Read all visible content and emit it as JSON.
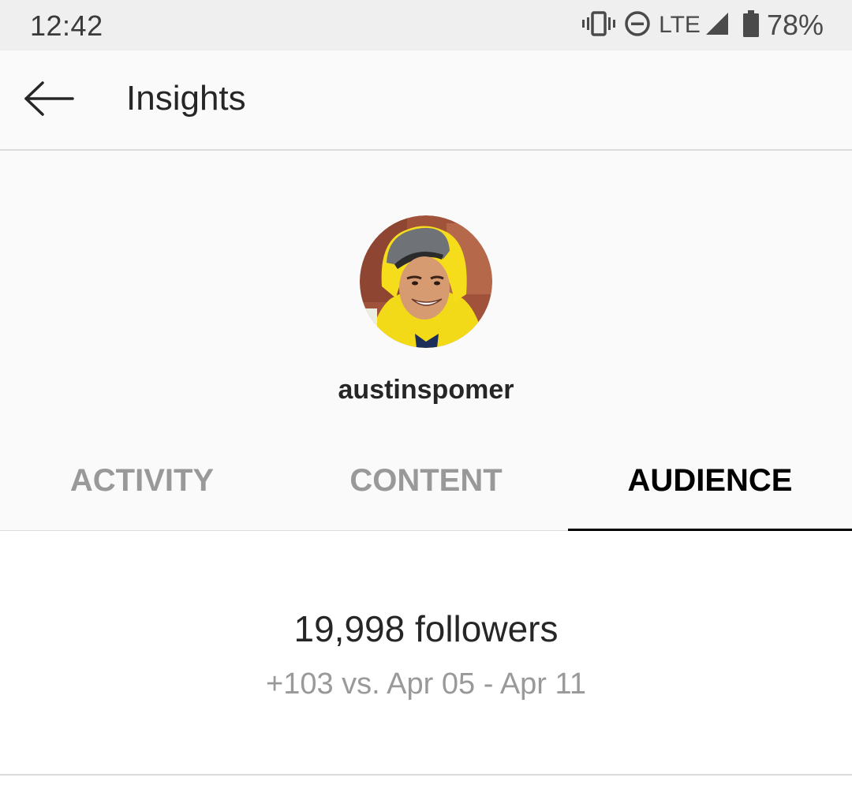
{
  "status_bar": {
    "time": "12:42",
    "network": "LTE",
    "battery": "78%",
    "icons": [
      "vibrate-icon",
      "do-not-disturb-icon",
      "signal-icon",
      "battery-icon"
    ]
  },
  "app_bar": {
    "title": "Insights",
    "back_icon": "arrow-left-icon"
  },
  "profile": {
    "username": "austinspomer",
    "avatar": "profile-photo"
  },
  "tabs": [
    {
      "label": "ACTIVITY",
      "active": false
    },
    {
      "label": "CONTENT",
      "active": false
    },
    {
      "label": "AUDIENCE",
      "active": true
    }
  ],
  "audience": {
    "followers": "19,998 followers",
    "change": "+103 vs. Apr 05 - Apr 11"
  },
  "colors": {
    "active_tab": "#000000",
    "inactive_tab": "#999999",
    "header_bg": "#fafafa",
    "status_bg": "#efefef"
  }
}
